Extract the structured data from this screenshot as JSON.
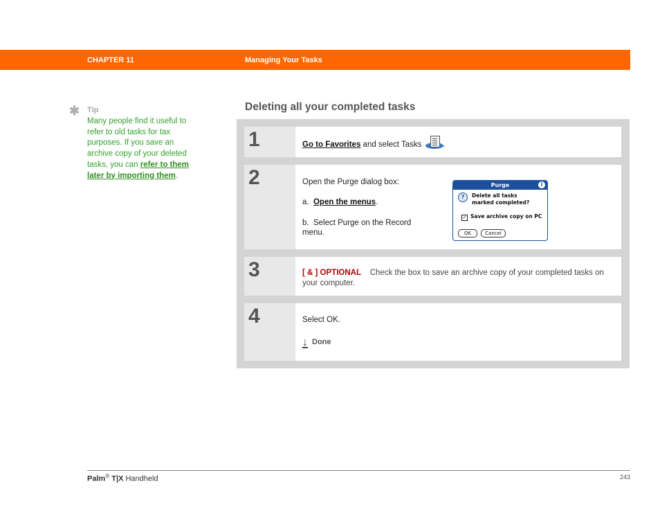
{
  "header": {
    "chapter": "CHAPTER 11",
    "title": "Managing Your Tasks",
    "accent_color": "#ff6600"
  },
  "tip": {
    "icon": "asterisk-icon",
    "label": "Tip",
    "text": "Many people find it useful to refer to old tasks for tax purposes. If you save an archive copy of your deleted tasks, you can ",
    "link": "refer to them later by importing them",
    "after": "."
  },
  "section": {
    "title": "Deleting all your completed tasks"
  },
  "steps": [
    {
      "number": "1",
      "link": "Go to Favorites",
      "text": " and select Tasks",
      "icon": "tasks-app-icon",
      "after": "."
    },
    {
      "number": "2",
      "intro": "Open the Purge dialog box:",
      "sub_a_prefix": "a.",
      "sub_a_link": "Open the menus",
      "sub_a_after": ".",
      "sub_b_prefix": "b.",
      "sub_b_text": "Select Purge on the Record menu.",
      "dialog": {
        "title": "Purge",
        "message_line1": "Delete all tasks",
        "message_line2": "marked completed?",
        "checkbox_label": "Save archive copy on PC",
        "checkbox_checked": true,
        "ok": "OK",
        "cancel": "Cancel"
      }
    },
    {
      "number": "3",
      "tag": "[ & ]  OPTIONAL",
      "text": "Check the box to save an archive copy of your completed tasks on your computer."
    },
    {
      "number": "4",
      "text": "Select OK.",
      "done": "Done"
    }
  ],
  "footer": {
    "brand": "Palm",
    "reg": "®",
    "model": "T|X",
    "suffix": " Handheld",
    "page": "243"
  }
}
